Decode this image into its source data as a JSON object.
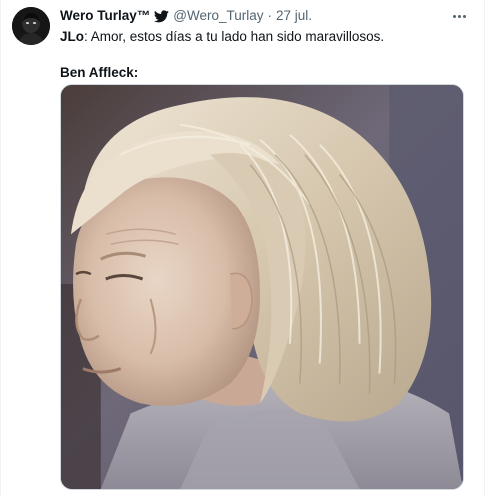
{
  "tweet": {
    "display_name": "Wero Turlay™",
    "handle": "@Wero_Turlay",
    "separator": "·",
    "date": "27 jul.",
    "text_line1_speaker": "JLo",
    "text_line1_body": ": Amor, estos días a tu lado han sido maravillosos.",
    "text_line2": "Ben Affleck:"
  },
  "icons": {
    "verified": "twitter-bird-icon",
    "more": "more-options-icon",
    "avatar": "profile-avatar"
  },
  "colors": {
    "text": "#0f1419",
    "secondary_text": "#536471",
    "border": "#cfd9de"
  }
}
